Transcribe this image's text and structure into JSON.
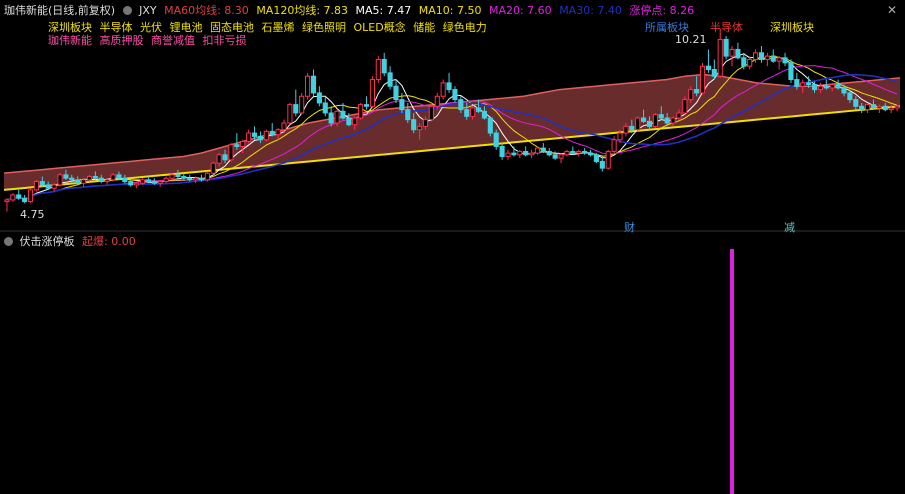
{
  "header": {
    "stock_name": "珈伟新能(日线,前复权)",
    "indicator_name": "JXY",
    "ma60": "MA60均线: 8.30",
    "ma120": "MA120均线: 7.83",
    "ma5": "MA5: 7.47",
    "ma10": "MA10: 7.50",
    "ma20": "MA20: 7.60",
    "ma30": "MA30: 7.40",
    "limit_point": "涨停点: 8.26",
    "colors": {
      "ma60": "#e04040",
      "ma120": "#f0e000",
      "ma5": "#ffffff",
      "ma10": "#f0e000",
      "ma20": "#e020e0",
      "ma30": "#2030c0",
      "limit": "#ff40a0"
    }
  },
  "tags_line1": [
    "深圳板块",
    "半导体",
    "光伏",
    "锂电池",
    "固态电池",
    "石墨烯",
    "绿色照明",
    "OLED概念",
    "储能",
    "绿色电力"
  ],
  "tags_line2": [
    "珈伟新能",
    "高质押股",
    "商誉减值",
    "扣非亏损"
  ],
  "annotations": {
    "sector1": "所属板块",
    "sector2": "半导体",
    "sector3": "深圳板块",
    "high_price": "10.21",
    "low_price": "4.75",
    "mark_cai": "财",
    "mark_jian": "减"
  },
  "close_icon": "close-icon",
  "sub_panel": {
    "title": "伏击涨停板",
    "value_text": "起爆: 0.00"
  },
  "chart_data": [
    {
      "type": "candlestick",
      "title": "珈伟新能(日线,前复权)",
      "ylim": [
        4.5,
        10.6
      ],
      "ohlc": [
        [
          5.05,
          5.15,
          4.75,
          5.1
        ],
        [
          5.1,
          5.3,
          5.05,
          5.25
        ],
        [
          5.25,
          5.4,
          5.1,
          5.15
        ],
        [
          5.15,
          5.25,
          5.0,
          5.05
        ],
        [
          5.05,
          5.45,
          5.0,
          5.4
        ],
        [
          5.4,
          5.7,
          5.35,
          5.65
        ],
        [
          5.65,
          5.8,
          5.5,
          5.55
        ],
        [
          5.55,
          5.65,
          5.4,
          5.45
        ],
        [
          5.45,
          5.6,
          5.35,
          5.55
        ],
        [
          5.55,
          5.9,
          5.5,
          5.85
        ],
        [
          5.85,
          6.0,
          5.7,
          5.75
        ],
        [
          5.75,
          5.85,
          5.6,
          5.7
        ],
        [
          5.7,
          5.8,
          5.55,
          5.6
        ],
        [
          5.6,
          5.75,
          5.5,
          5.7
        ],
        [
          5.7,
          5.85,
          5.65,
          5.8
        ],
        [
          5.8,
          5.95,
          5.7,
          5.75
        ],
        [
          5.75,
          5.85,
          5.6,
          5.65
        ],
        [
          5.65,
          5.75,
          5.55,
          5.7
        ],
        [
          5.7,
          5.9,
          5.65,
          5.85
        ],
        [
          5.85,
          5.95,
          5.7,
          5.75
        ],
        [
          5.75,
          5.85,
          5.6,
          5.65
        ],
        [
          5.65,
          5.7,
          5.5,
          5.55
        ],
        [
          5.55,
          5.65,
          5.45,
          5.6
        ],
        [
          5.6,
          5.75,
          5.55,
          5.7
        ],
        [
          5.7,
          5.8,
          5.6,
          5.65
        ],
        [
          5.65,
          5.75,
          5.55,
          5.6
        ],
        [
          5.6,
          5.7,
          5.5,
          5.65
        ],
        [
          5.65,
          5.8,
          5.6,
          5.75
        ],
        [
          5.75,
          5.9,
          5.7,
          5.85
        ],
        [
          5.85,
          6.0,
          5.75,
          5.8
        ],
        [
          5.8,
          5.9,
          5.7,
          5.75
        ],
        [
          5.75,
          5.85,
          5.65,
          5.7
        ],
        [
          5.7,
          5.8,
          5.6,
          5.75
        ],
        [
          5.75,
          5.85,
          5.65,
          5.7
        ],
        [
          5.7,
          5.95,
          5.65,
          5.9
        ],
        [
          5.9,
          6.25,
          5.85,
          6.2
        ],
        [
          6.2,
          6.5,
          6.1,
          6.45
        ],
        [
          6.45,
          6.6,
          6.2,
          6.3
        ],
        [
          6.3,
          6.8,
          6.25,
          6.75
        ],
        [
          6.75,
          7.1,
          6.6,
          6.7
        ],
        [
          6.7,
          6.9,
          6.5,
          6.85
        ],
        [
          6.85,
          7.2,
          6.8,
          7.1
        ],
        [
          7.1,
          7.3,
          6.9,
          7.0
        ],
        [
          7.0,
          7.15,
          6.8,
          6.9
        ],
        [
          6.9,
          7.2,
          6.85,
          7.15
        ],
        [
          7.15,
          7.4,
          7.0,
          7.05
        ],
        [
          7.05,
          7.25,
          6.9,
          7.2
        ],
        [
          7.2,
          7.5,
          7.1,
          7.4
        ],
        [
          7.4,
          8.0,
          7.35,
          7.95
        ],
        [
          7.95,
          8.4,
          7.6,
          7.7
        ],
        [
          7.7,
          8.3,
          7.65,
          8.2
        ],
        [
          8.2,
          8.9,
          8.1,
          8.8
        ],
        [
          8.8,
          9.0,
          8.2,
          8.3
        ],
        [
          8.3,
          8.5,
          7.9,
          8.0
        ],
        [
          8.0,
          8.2,
          7.6,
          7.7
        ],
        [
          7.7,
          7.9,
          7.3,
          7.4
        ],
        [
          7.4,
          7.8,
          7.3,
          7.75
        ],
        [
          7.75,
          8.0,
          7.5,
          7.55
        ],
        [
          7.55,
          7.7,
          7.3,
          7.35
        ],
        [
          7.35,
          7.6,
          7.2,
          7.55
        ],
        [
          7.55,
          8.0,
          7.5,
          7.95
        ],
        [
          7.95,
          8.2,
          7.8,
          7.9
        ],
        [
          7.9,
          8.8,
          7.85,
          8.7
        ],
        [
          8.7,
          9.4,
          8.6,
          9.3
        ],
        [
          9.3,
          9.5,
          8.8,
          8.9
        ],
        [
          8.9,
          9.1,
          8.4,
          8.5
        ],
        [
          8.5,
          8.7,
          8.0,
          8.1
        ],
        [
          8.1,
          8.3,
          7.7,
          7.8
        ],
        [
          7.8,
          8.0,
          7.4,
          7.5
        ],
        [
          7.5,
          7.7,
          7.1,
          7.2
        ],
        [
          7.2,
          7.4,
          6.9,
          7.3
        ],
        [
          7.3,
          7.6,
          7.2,
          7.5
        ],
        [
          7.5,
          8.0,
          7.45,
          7.9
        ],
        [
          7.9,
          8.3,
          7.8,
          8.2
        ],
        [
          8.2,
          8.7,
          8.1,
          8.6
        ],
        [
          8.6,
          8.9,
          8.3,
          8.4
        ],
        [
          8.4,
          8.5,
          8.0,
          8.1
        ],
        [
          8.1,
          8.2,
          7.7,
          7.8
        ],
        [
          7.8,
          8.0,
          7.5,
          7.6
        ],
        [
          7.6,
          7.9,
          7.5,
          7.85
        ],
        [
          7.85,
          8.1,
          7.7,
          7.75
        ],
        [
          7.75,
          7.9,
          7.5,
          7.55
        ],
        [
          7.55,
          7.6,
          7.0,
          7.1
        ],
        [
          7.1,
          7.2,
          6.6,
          6.7
        ],
        [
          6.7,
          6.8,
          6.3,
          6.4
        ],
        [
          6.4,
          6.6,
          6.3,
          6.5
        ],
        [
          6.5,
          6.7,
          6.4,
          6.45
        ],
        [
          6.45,
          6.6,
          6.35,
          6.55
        ],
        [
          6.55,
          6.7,
          6.4,
          6.45
        ],
        [
          6.45,
          6.6,
          6.35,
          6.5
        ],
        [
          6.5,
          6.7,
          6.45,
          6.65
        ],
        [
          6.65,
          6.8,
          6.5,
          6.55
        ],
        [
          6.55,
          6.65,
          6.4,
          6.45
        ],
        [
          6.45,
          6.55,
          6.3,
          6.35
        ],
        [
          6.35,
          6.5,
          6.2,
          6.45
        ],
        [
          6.45,
          6.6,
          6.4,
          6.55
        ],
        [
          6.55,
          6.7,
          6.45,
          6.5
        ],
        [
          6.5,
          6.6,
          6.4,
          6.55
        ],
        [
          6.55,
          6.65,
          6.45,
          6.5
        ],
        [
          6.5,
          6.6,
          6.4,
          6.45
        ],
        [
          6.45,
          6.5,
          6.2,
          6.25
        ],
        [
          6.25,
          6.4,
          5.95,
          6.05
        ],
        [
          6.05,
          6.6,
          6.0,
          6.55
        ],
        [
          6.55,
          7.0,
          6.5,
          6.9
        ],
        [
          6.9,
          7.2,
          6.8,
          7.1
        ],
        [
          7.1,
          7.4,
          7.0,
          7.3
        ],
        [
          7.3,
          7.5,
          7.1,
          7.2
        ],
        [
          7.2,
          7.6,
          7.15,
          7.55
        ],
        [
          7.55,
          7.8,
          7.4,
          7.45
        ],
        [
          7.45,
          7.6,
          7.2,
          7.3
        ],
        [
          7.3,
          7.7,
          7.25,
          7.65
        ],
        [
          7.65,
          7.9,
          7.5,
          7.55
        ],
        [
          7.55,
          7.7,
          7.3,
          7.4
        ],
        [
          7.4,
          7.6,
          7.3,
          7.55
        ],
        [
          7.55,
          7.8,
          7.5,
          7.7
        ],
        [
          7.7,
          8.2,
          7.65,
          8.1
        ],
        [
          8.1,
          8.5,
          8.0,
          8.4
        ],
        [
          8.4,
          8.8,
          8.2,
          8.3
        ],
        [
          8.3,
          9.2,
          8.25,
          9.1
        ],
        [
          9.1,
          9.6,
          8.9,
          9.0
        ],
        [
          9.0,
          9.3,
          8.7,
          8.8
        ],
        [
          8.8,
          10.21,
          8.75,
          9.9
        ],
        [
          9.9,
          10.0,
          9.3,
          9.4
        ],
        [
          9.4,
          9.7,
          9.1,
          9.6
        ],
        [
          9.6,
          9.8,
          9.3,
          9.35
        ],
        [
          9.35,
          9.5,
          9.0,
          9.1
        ],
        [
          9.1,
          9.4,
          9.0,
          9.3
        ],
        [
          9.3,
          9.6,
          9.2,
          9.5
        ],
        [
          9.5,
          9.7,
          9.2,
          9.3
        ],
        [
          9.3,
          9.5,
          9.1,
          9.4
        ],
        [
          9.4,
          9.6,
          9.2,
          9.25
        ],
        [
          9.25,
          9.4,
          9.0,
          9.35
        ],
        [
          9.35,
          9.5,
          9.1,
          9.2
        ],
        [
          9.2,
          9.3,
          8.6,
          8.7
        ],
        [
          8.7,
          8.9,
          8.4,
          8.5
        ],
        [
          8.5,
          8.7,
          8.3,
          8.6
        ],
        [
          8.6,
          8.8,
          8.45,
          8.55
        ],
        [
          8.55,
          8.65,
          8.3,
          8.4
        ],
        [
          8.4,
          8.6,
          8.3,
          8.5
        ],
        [
          8.5,
          8.7,
          8.4,
          8.45
        ],
        [
          8.45,
          8.6,
          8.35,
          8.55
        ],
        [
          8.55,
          8.7,
          8.4,
          8.45
        ],
        [
          8.45,
          8.55,
          8.2,
          8.3
        ],
        [
          8.3,
          8.4,
          8.0,
          8.1
        ],
        [
          8.1,
          8.2,
          7.8,
          7.9
        ],
        [
          7.9,
          8.0,
          7.7,
          7.8
        ],
        [
          7.8,
          8.0,
          7.7,
          7.95
        ],
        [
          7.95,
          8.1,
          7.8,
          7.85
        ],
        [
          7.85,
          7.95,
          7.7,
          7.9
        ],
        [
          7.9,
          8.0,
          7.75,
          7.8
        ],
        [
          7.8,
          7.95,
          7.7,
          7.85
        ],
        [
          7.85,
          7.95,
          7.75,
          7.9
        ]
      ],
      "lines": [
        {
          "name": "MA5",
          "color": "#ffffff"
        },
        {
          "name": "MA10",
          "color": "#f0e000"
        },
        {
          "name": "MA20",
          "color": "#e020e0"
        },
        {
          "name": "MA30",
          "color": "#2030c0"
        }
      ],
      "bands": [
        {
          "upper": [
            5.9,
            5.95,
            6.0,
            6.05,
            6.1,
            6.15,
            6.2,
            6.25,
            6.3,
            6.35,
            6.4,
            6.5,
            6.65,
            6.8,
            6.95,
            7.1,
            7.25,
            7.4,
            7.5,
            7.6,
            7.7,
            7.8,
            7.85,
            7.9,
            7.95,
            8.0,
            8.05,
            8.1,
            8.15,
            8.2,
            8.3,
            8.4,
            8.45,
            8.5,
            8.55,
            8.6,
            8.65,
            8.7,
            8.8,
            8.85,
            8.8,
            8.7,
            8.6,
            8.55,
            8.5,
            8.5,
            8.55,
            8.6,
            8.65,
            8.7,
            8.75
          ],
          "lower": [
            5.4,
            5.45,
            5.5,
            5.55,
            5.6,
            5.65,
            5.7,
            5.75,
            5.8,
            5.85,
            5.9,
            5.95,
            6.0,
            6.05,
            6.1,
            6.15,
            6.2,
            6.25,
            6.3,
            6.35,
            6.4,
            6.45,
            6.5,
            6.55,
            6.6,
            6.65,
            6.7,
            6.75,
            6.8,
            6.85,
            6.9,
            6.95,
            7.0,
            7.05,
            7.1,
            7.15,
            7.2,
            7.25,
            7.3,
            7.35,
            7.4,
            7.45,
            7.5,
            7.55,
            7.6,
            7.65,
            7.7,
            7.75,
            7.8,
            7.85,
            7.9
          ]
        }
      ]
    },
    {
      "type": "bar",
      "title": "伏击涨停板",
      "series": [
        {
          "name": "起爆",
          "spike_index": 123,
          "value": 1
        }
      ],
      "value_label": "起爆: 0.00"
    }
  ]
}
